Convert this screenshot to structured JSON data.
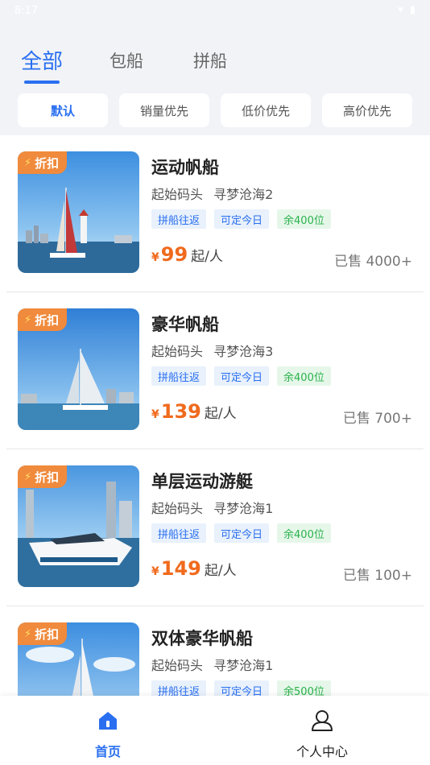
{
  "status_bar": {
    "time": "8:17",
    "icons": "▾ ▮"
  },
  "tabs": [
    {
      "label": "全部",
      "active": true
    },
    {
      "label": "包船",
      "active": false
    },
    {
      "label": "拼船",
      "active": false
    }
  ],
  "sort_options": [
    {
      "label": "默认",
      "active": true
    },
    {
      "label": "销量优先",
      "active": false
    },
    {
      "label": "低价优先",
      "active": false
    },
    {
      "label": "高价优先",
      "active": false
    }
  ],
  "products": [
    {
      "badge": "折扣",
      "title": "运动帆船",
      "pier": "起始码头",
      "route": "寻梦沧海2",
      "tags": [
        "拼船往返",
        "可定今日",
        "余400位"
      ],
      "currency": "¥",
      "price": "99",
      "unit": "起/人",
      "sold": "已售 4000+"
    },
    {
      "badge": "折扣",
      "title": "豪华帆船",
      "pier": "起始码头",
      "route": "寻梦沧海3",
      "tags": [
        "拼船往返",
        "可定今日",
        "余400位"
      ],
      "currency": "¥",
      "price": "139",
      "unit": "起/人",
      "sold": "已售 700+"
    },
    {
      "badge": "折扣",
      "title": "单层运动游艇",
      "pier": "起始码头",
      "route": "寻梦沧海1",
      "tags": [
        "拼船往返",
        "可定今日",
        "余400位"
      ],
      "currency": "¥",
      "price": "149",
      "unit": "起/人",
      "sold": "已售 100+"
    },
    {
      "badge": "折扣",
      "title": "双体豪华帆船",
      "pier": "起始码头",
      "route": "寻梦沧海1",
      "tags": [
        "拼船往返",
        "可定今日",
        "余500位"
      ],
      "currency": "¥",
      "price": "",
      "unit": "",
      "sold": ""
    }
  ],
  "bottom_nav": [
    {
      "label": "首页",
      "icon": "home-icon",
      "active": true
    },
    {
      "label": "个人中心",
      "icon": "user-icon",
      "active": false
    }
  ],
  "colors": {
    "accent": "#2a6ff0",
    "price": "#f06a1d",
    "badge": "#f08a3c",
    "green_tag": "#2bb24c"
  }
}
